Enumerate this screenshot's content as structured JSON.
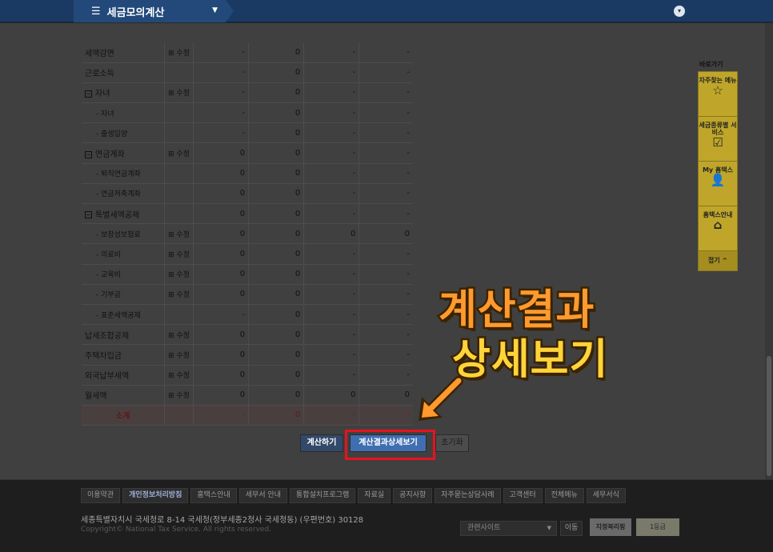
{
  "topbar": {
    "menu_label": "세금모의계산",
    "hamburger": "☰",
    "caret": "▼",
    "collapse": "▾"
  },
  "table": {
    "rows": [
      {
        "label": "세액감면",
        "toggle": "",
        "edit": "⊞ 수정",
        "v1": "-",
        "v2": "0",
        "v3": "-",
        "v4": "-",
        "indent": false
      },
      {
        "label": "근로소득",
        "toggle": "",
        "edit": "",
        "v1": "-",
        "v2": "0",
        "v3": "-",
        "v4": "-",
        "indent": false
      },
      {
        "label": "자녀",
        "toggle": "−",
        "edit": "⊞ 수정",
        "v1": "-",
        "v2": "0",
        "v3": "-",
        "v4": "-",
        "indent": false
      },
      {
        "label": "- 자녀",
        "toggle": "",
        "edit": "",
        "v1": "-",
        "v2": "0",
        "v3": "-",
        "v4": "-",
        "indent": true
      },
      {
        "label": "- 출생입양",
        "toggle": "",
        "edit": "",
        "v1": "-",
        "v2": "0",
        "v3": "-",
        "v4": "-",
        "indent": true
      },
      {
        "label": "연금계좌",
        "toggle": "−",
        "edit": "⊞ 수정",
        "v1": "0",
        "v2": "0",
        "v3": "-",
        "v4": "-",
        "indent": false
      },
      {
        "label": "- 퇴직연금계좌",
        "toggle": "",
        "edit": "",
        "v1": "0",
        "v2": "0",
        "v3": "-",
        "v4": "-",
        "indent": true
      },
      {
        "label": "- 연금저축계좌",
        "toggle": "",
        "edit": "",
        "v1": "0",
        "v2": "0",
        "v3": "-",
        "v4": "-",
        "indent": true
      },
      {
        "label": "특별세액공제",
        "toggle": "−",
        "edit": "",
        "v1": "0",
        "v2": "0",
        "v3": "-",
        "v4": "-",
        "indent": false
      },
      {
        "label": "- 보장성보험료",
        "toggle": "",
        "edit": "⊞ 수정",
        "v1": "0",
        "v2": "0",
        "v3": "0",
        "v4": "0",
        "indent": true
      },
      {
        "label": "- 의료비",
        "toggle": "",
        "edit": "⊞ 수정",
        "v1": "0",
        "v2": "0",
        "v3": "-",
        "v4": "-",
        "indent": true
      },
      {
        "label": "- 교육비",
        "toggle": "",
        "edit": "⊞ 수정",
        "v1": "0",
        "v2": "0",
        "v3": "-",
        "v4": "-",
        "indent": true
      },
      {
        "label": "- 기부금",
        "toggle": "",
        "edit": "⊞ 수정",
        "v1": "0",
        "v2": "0",
        "v3": "-",
        "v4": "-",
        "indent": true
      },
      {
        "label": "- 표준세액공제",
        "toggle": "",
        "edit": "",
        "v1": "-",
        "v2": "0",
        "v3": "-",
        "v4": "-",
        "indent": true
      },
      {
        "label": "납세조합공제",
        "toggle": "",
        "edit": "⊞ 수정",
        "v1": "0",
        "v2": "0",
        "v3": "-",
        "v4": "-",
        "indent": false
      },
      {
        "label": "주택차입금",
        "toggle": "",
        "edit": "⊞ 수정",
        "v1": "0",
        "v2": "0",
        "v3": "-",
        "v4": "-",
        "indent": false
      },
      {
        "label": "외국납부세액",
        "toggle": "",
        "edit": "⊞ 수정",
        "v1": "0",
        "v2": "0",
        "v3": "-",
        "v4": "-",
        "indent": false
      },
      {
        "label": "월세액",
        "toggle": "",
        "edit": "⊞ 수정",
        "v1": "0",
        "v2": "0",
        "v3": "0",
        "v4": "0",
        "indent": false
      }
    ],
    "subtotal": {
      "label": "소계",
      "v1": "-",
      "v2": "0",
      "v3": "-",
      "v4": "-"
    }
  },
  "buttons": {
    "calc": "계산하기",
    "detail": "계산결과상세보기",
    "reset": "초기화"
  },
  "overlay": {
    "line1": "계산결과",
    "line2": "상세보기",
    "colors": {
      "line1": "#ff9a2e",
      "line2": "#ffd43a",
      "highlight": "#e8121e"
    }
  },
  "quick": {
    "title": "바로가기",
    "items": [
      {
        "label": "자주찾는 메뉴",
        "icon": "star-icon",
        "glyph": "☆"
      },
      {
        "label": "세금종류별 서비스",
        "icon": "checkbox-icon",
        "glyph": "☑"
      },
      {
        "label": "My 홈택스",
        "icon": "user-icon",
        "glyph": "👤"
      },
      {
        "label": "홈택스안내",
        "icon": "house-icon",
        "glyph": "⌂"
      }
    ],
    "fold": "접기 ^"
  },
  "footer": {
    "links": [
      "이용약관",
      "개인정보처리방침",
      "홈택스안내",
      "세무서 안내",
      "통합설치프로그램",
      "자료실",
      "공지사항",
      "자주묻는상담사례",
      "고객센터",
      "전체메뉴",
      "세무서식"
    ],
    "address": "세종특별자치시 국세청로 8-14 국세청(정부세종2청사 국세청동) (우편번호) 30128",
    "copyright": "Copyright© National Tax Service. All rights reserved.",
    "related_site": "관련사이트",
    "go": "이동",
    "badge1": "지정북리핑",
    "badge2": "1등급"
  }
}
